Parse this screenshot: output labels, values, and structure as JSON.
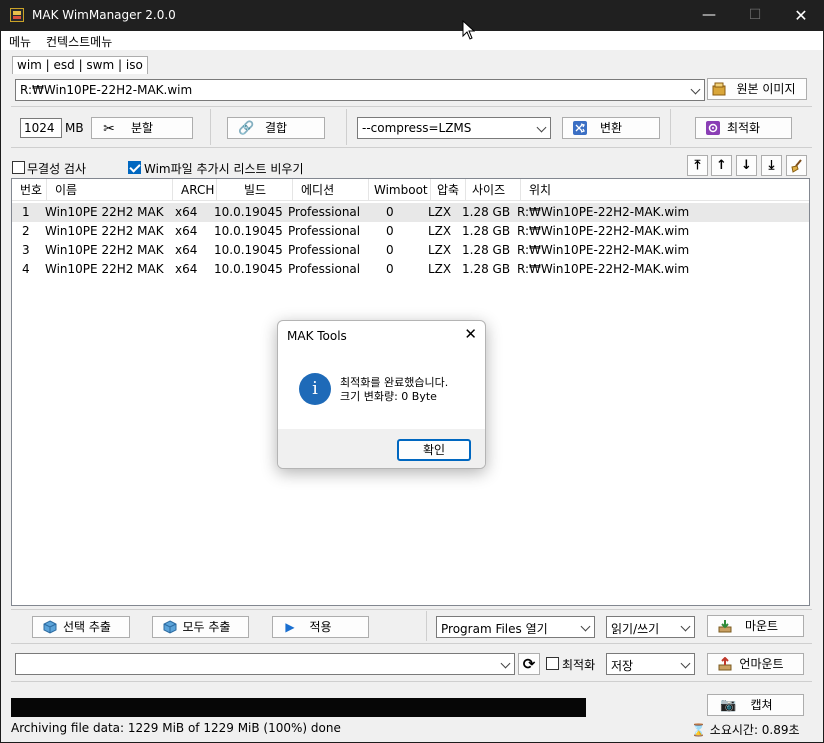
{
  "window": {
    "title": "MAK WimManager 2.0.0",
    "min_icon": "minimize-icon",
    "max_icon": "maximize-icon",
    "close_icon": "close-icon"
  },
  "menu": {
    "items": [
      "메뉴",
      "컨텍스트메뉴"
    ]
  },
  "filter_tabs": "wim | esd | swm | iso",
  "path_combo": {
    "value": "R:₩Win10PE-22H2-MAK.wim"
  },
  "source_image_button": "원본 이미지",
  "split": {
    "size": "1024",
    "unit": "MB",
    "button": "분할"
  },
  "merge_button": "결합",
  "compress_combo": {
    "value": "--compress=LZMS"
  },
  "convert_button": "변환",
  "optimize_button": "최적화",
  "options": {
    "integrity_check": {
      "label": "무결성 검사",
      "checked": false
    },
    "clear_list": {
      "label": "Wim파일 추가시 리스트 비우기",
      "checked": true
    }
  },
  "order_buttons": [
    "⤒",
    "↑",
    "↓",
    "⤓"
  ],
  "table": {
    "columns": [
      "번호",
      "이름",
      "ARCH",
      "빌드",
      "에디션",
      "Wimboot",
      "압축",
      "사이즈",
      "위치"
    ],
    "rows": [
      [
        "1",
        "Win10PE 22H2 MAK",
        "x64",
        "10.0.19045",
        "Professional",
        "0",
        "LZX",
        "1.28 GB",
        "R:₩Win10PE-22H2-MAK.wim"
      ],
      [
        "2",
        "Win10PE 22H2 MAK",
        "x64",
        "10.0.19045",
        "Professional",
        "0",
        "LZX",
        "1.28 GB",
        "R:₩Win10PE-22H2-MAK.wim"
      ],
      [
        "3",
        "Win10PE 22H2 MAK",
        "x64",
        "10.0.19045",
        "Professional",
        "0",
        "LZX",
        "1.28 GB",
        "R:₩Win10PE-22H2-MAK.wim"
      ],
      [
        "4",
        "Win10PE 22H2 MAK",
        "x64",
        "10.0.19045",
        "Professional",
        "0",
        "LZX",
        "1.28 GB",
        "R:₩Win10PE-22H2-MAK.wim"
      ]
    ]
  },
  "bottom": {
    "extract_selected": "선택 추출",
    "extract_all": "모두 추출",
    "apply": "적용",
    "program_files_combo": "Program Files 열기",
    "rw_combo": "읽기/쓰기",
    "mount": "마운트",
    "target_combo": "",
    "optimize_check": {
      "label": "최적화",
      "checked": false
    },
    "save_combo": "저장",
    "unmount": "언마운트",
    "capture": "캡쳐"
  },
  "status": {
    "text": "Archiving file data: 1229 MiB of 1229 MiB (100%) done",
    "elapsed": "소요시간: 0.89초",
    "progress": 1.0
  },
  "dialog": {
    "title": "MAK Tools",
    "message_line1": "최적화를 완료했습니다.",
    "message_line2": "크기 변화량: 0 Byte",
    "ok": "확인",
    "icon": "info-icon"
  },
  "colors": {
    "accent": "#0067c0",
    "titlebar": "#202020",
    "info": "#1e6ab8"
  }
}
